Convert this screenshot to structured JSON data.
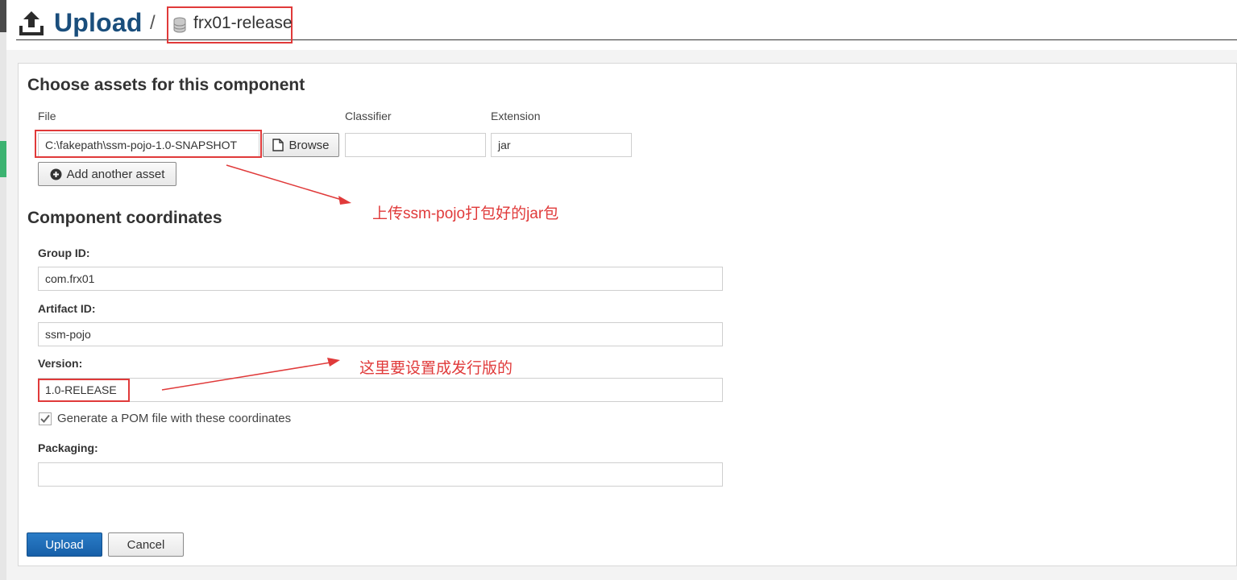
{
  "header": {
    "title": "Upload",
    "separator": "/",
    "repository": "frx01-release",
    "upload_icon": "upload-icon",
    "repo_icon": "database-icon"
  },
  "assets": {
    "section_title": "Choose assets for this component",
    "file_label": "File",
    "classifier_label": "Classifier",
    "extension_label": "Extension",
    "file_value": "C:\\fakepath\\ssm-pojo-1.0-SNAPSHOT",
    "browse_label": "Browse",
    "classifier_value": "",
    "extension_value": "jar",
    "add_asset_label": "Add another asset"
  },
  "coordinates": {
    "section_title": "Component coordinates",
    "group_label": "Group ID:",
    "group_value": "com.frx01",
    "artifact_label": "Artifact ID:",
    "artifact_value": "ssm-pojo",
    "version_label": "Version:",
    "version_value": "1.0-RELEASE",
    "generate_pom_label": "Generate a POM file with these coordinates",
    "generate_pom_checked": true,
    "packaging_label": "Packaging:",
    "packaging_value": ""
  },
  "actions": {
    "upload_label": "Upload",
    "cancel_label": "Cancel"
  },
  "annotations": {
    "jar_note": "上传ssm-pojo打包好的jar包",
    "version_note": "这里要设置成发行版的",
    "color": "#e03a3a"
  },
  "colors": {
    "title": "#1a4e7c",
    "primary_button": "#1760a8",
    "highlight": "#e03a3a"
  }
}
